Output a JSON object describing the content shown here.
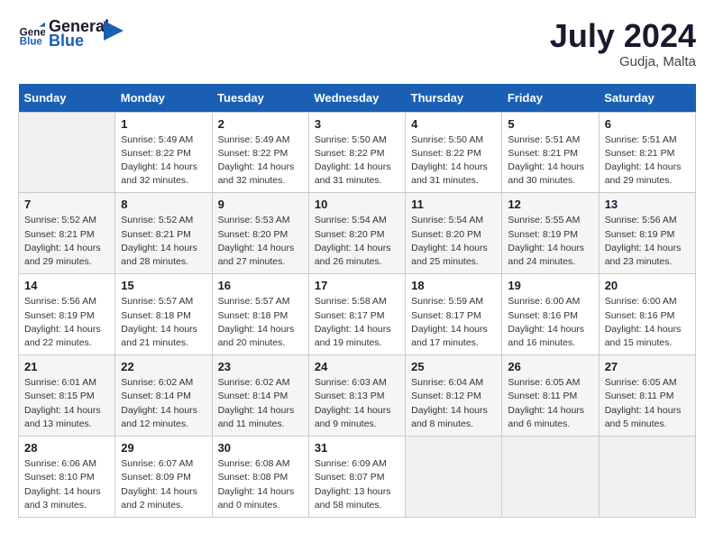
{
  "header": {
    "logo_general": "General",
    "logo_blue": "Blue",
    "month_year": "July 2024",
    "location": "Gudja, Malta"
  },
  "weekdays": [
    "Sunday",
    "Monday",
    "Tuesday",
    "Wednesday",
    "Thursday",
    "Friday",
    "Saturday"
  ],
  "weeks": [
    [
      null,
      {
        "day": "1",
        "sunrise": "5:49 AM",
        "sunset": "8:22 PM",
        "daylight": "14 hours and 32 minutes."
      },
      {
        "day": "2",
        "sunrise": "5:49 AM",
        "sunset": "8:22 PM",
        "daylight": "14 hours and 32 minutes."
      },
      {
        "day": "3",
        "sunrise": "5:50 AM",
        "sunset": "8:22 PM",
        "daylight": "14 hours and 31 minutes."
      },
      {
        "day": "4",
        "sunrise": "5:50 AM",
        "sunset": "8:22 PM",
        "daylight": "14 hours and 31 minutes."
      },
      {
        "day": "5",
        "sunrise": "5:51 AM",
        "sunset": "8:21 PM",
        "daylight": "14 hours and 30 minutes."
      },
      {
        "day": "6",
        "sunrise": "5:51 AM",
        "sunset": "8:21 PM",
        "daylight": "14 hours and 29 minutes."
      }
    ],
    [
      {
        "day": "7",
        "sunrise": "5:52 AM",
        "sunset": "8:21 PM",
        "daylight": "14 hours and 29 minutes."
      },
      {
        "day": "8",
        "sunrise": "5:52 AM",
        "sunset": "8:21 PM",
        "daylight": "14 hours and 28 minutes."
      },
      {
        "day": "9",
        "sunrise": "5:53 AM",
        "sunset": "8:20 PM",
        "daylight": "14 hours and 27 minutes."
      },
      {
        "day": "10",
        "sunrise": "5:54 AM",
        "sunset": "8:20 PM",
        "daylight": "14 hours and 26 minutes."
      },
      {
        "day": "11",
        "sunrise": "5:54 AM",
        "sunset": "8:20 PM",
        "daylight": "14 hours and 25 minutes."
      },
      {
        "day": "12",
        "sunrise": "5:55 AM",
        "sunset": "8:19 PM",
        "daylight": "14 hours and 24 minutes."
      },
      {
        "day": "13",
        "sunrise": "5:56 AM",
        "sunset": "8:19 PM",
        "daylight": "14 hours and 23 minutes."
      }
    ],
    [
      {
        "day": "14",
        "sunrise": "5:56 AM",
        "sunset": "8:19 PM",
        "daylight": "14 hours and 22 minutes."
      },
      {
        "day": "15",
        "sunrise": "5:57 AM",
        "sunset": "8:18 PM",
        "daylight": "14 hours and 21 minutes."
      },
      {
        "day": "16",
        "sunrise": "5:57 AM",
        "sunset": "8:18 PM",
        "daylight": "14 hours and 20 minutes."
      },
      {
        "day": "17",
        "sunrise": "5:58 AM",
        "sunset": "8:17 PM",
        "daylight": "14 hours and 19 minutes."
      },
      {
        "day": "18",
        "sunrise": "5:59 AM",
        "sunset": "8:17 PM",
        "daylight": "14 hours and 17 minutes."
      },
      {
        "day": "19",
        "sunrise": "6:00 AM",
        "sunset": "8:16 PM",
        "daylight": "14 hours and 16 minutes."
      },
      {
        "day": "20",
        "sunrise": "6:00 AM",
        "sunset": "8:16 PM",
        "daylight": "14 hours and 15 minutes."
      }
    ],
    [
      {
        "day": "21",
        "sunrise": "6:01 AM",
        "sunset": "8:15 PM",
        "daylight": "14 hours and 13 minutes."
      },
      {
        "day": "22",
        "sunrise": "6:02 AM",
        "sunset": "8:14 PM",
        "daylight": "14 hours and 12 minutes."
      },
      {
        "day": "23",
        "sunrise": "6:02 AM",
        "sunset": "8:14 PM",
        "daylight": "14 hours and 11 minutes."
      },
      {
        "day": "24",
        "sunrise": "6:03 AM",
        "sunset": "8:13 PM",
        "daylight": "14 hours and 9 minutes."
      },
      {
        "day": "25",
        "sunrise": "6:04 AM",
        "sunset": "8:12 PM",
        "daylight": "14 hours and 8 minutes."
      },
      {
        "day": "26",
        "sunrise": "6:05 AM",
        "sunset": "8:11 PM",
        "daylight": "14 hours and 6 minutes."
      },
      {
        "day": "27",
        "sunrise": "6:05 AM",
        "sunset": "8:11 PM",
        "daylight": "14 hours and 5 minutes."
      }
    ],
    [
      {
        "day": "28",
        "sunrise": "6:06 AM",
        "sunset": "8:10 PM",
        "daylight": "14 hours and 3 minutes."
      },
      {
        "day": "29",
        "sunrise": "6:07 AM",
        "sunset": "8:09 PM",
        "daylight": "14 hours and 2 minutes."
      },
      {
        "day": "30",
        "sunrise": "6:08 AM",
        "sunset": "8:08 PM",
        "daylight": "14 hours and 0 minutes."
      },
      {
        "day": "31",
        "sunrise": "6:09 AM",
        "sunset": "8:07 PM",
        "daylight": "13 hours and 58 minutes."
      },
      null,
      null,
      null
    ]
  ]
}
